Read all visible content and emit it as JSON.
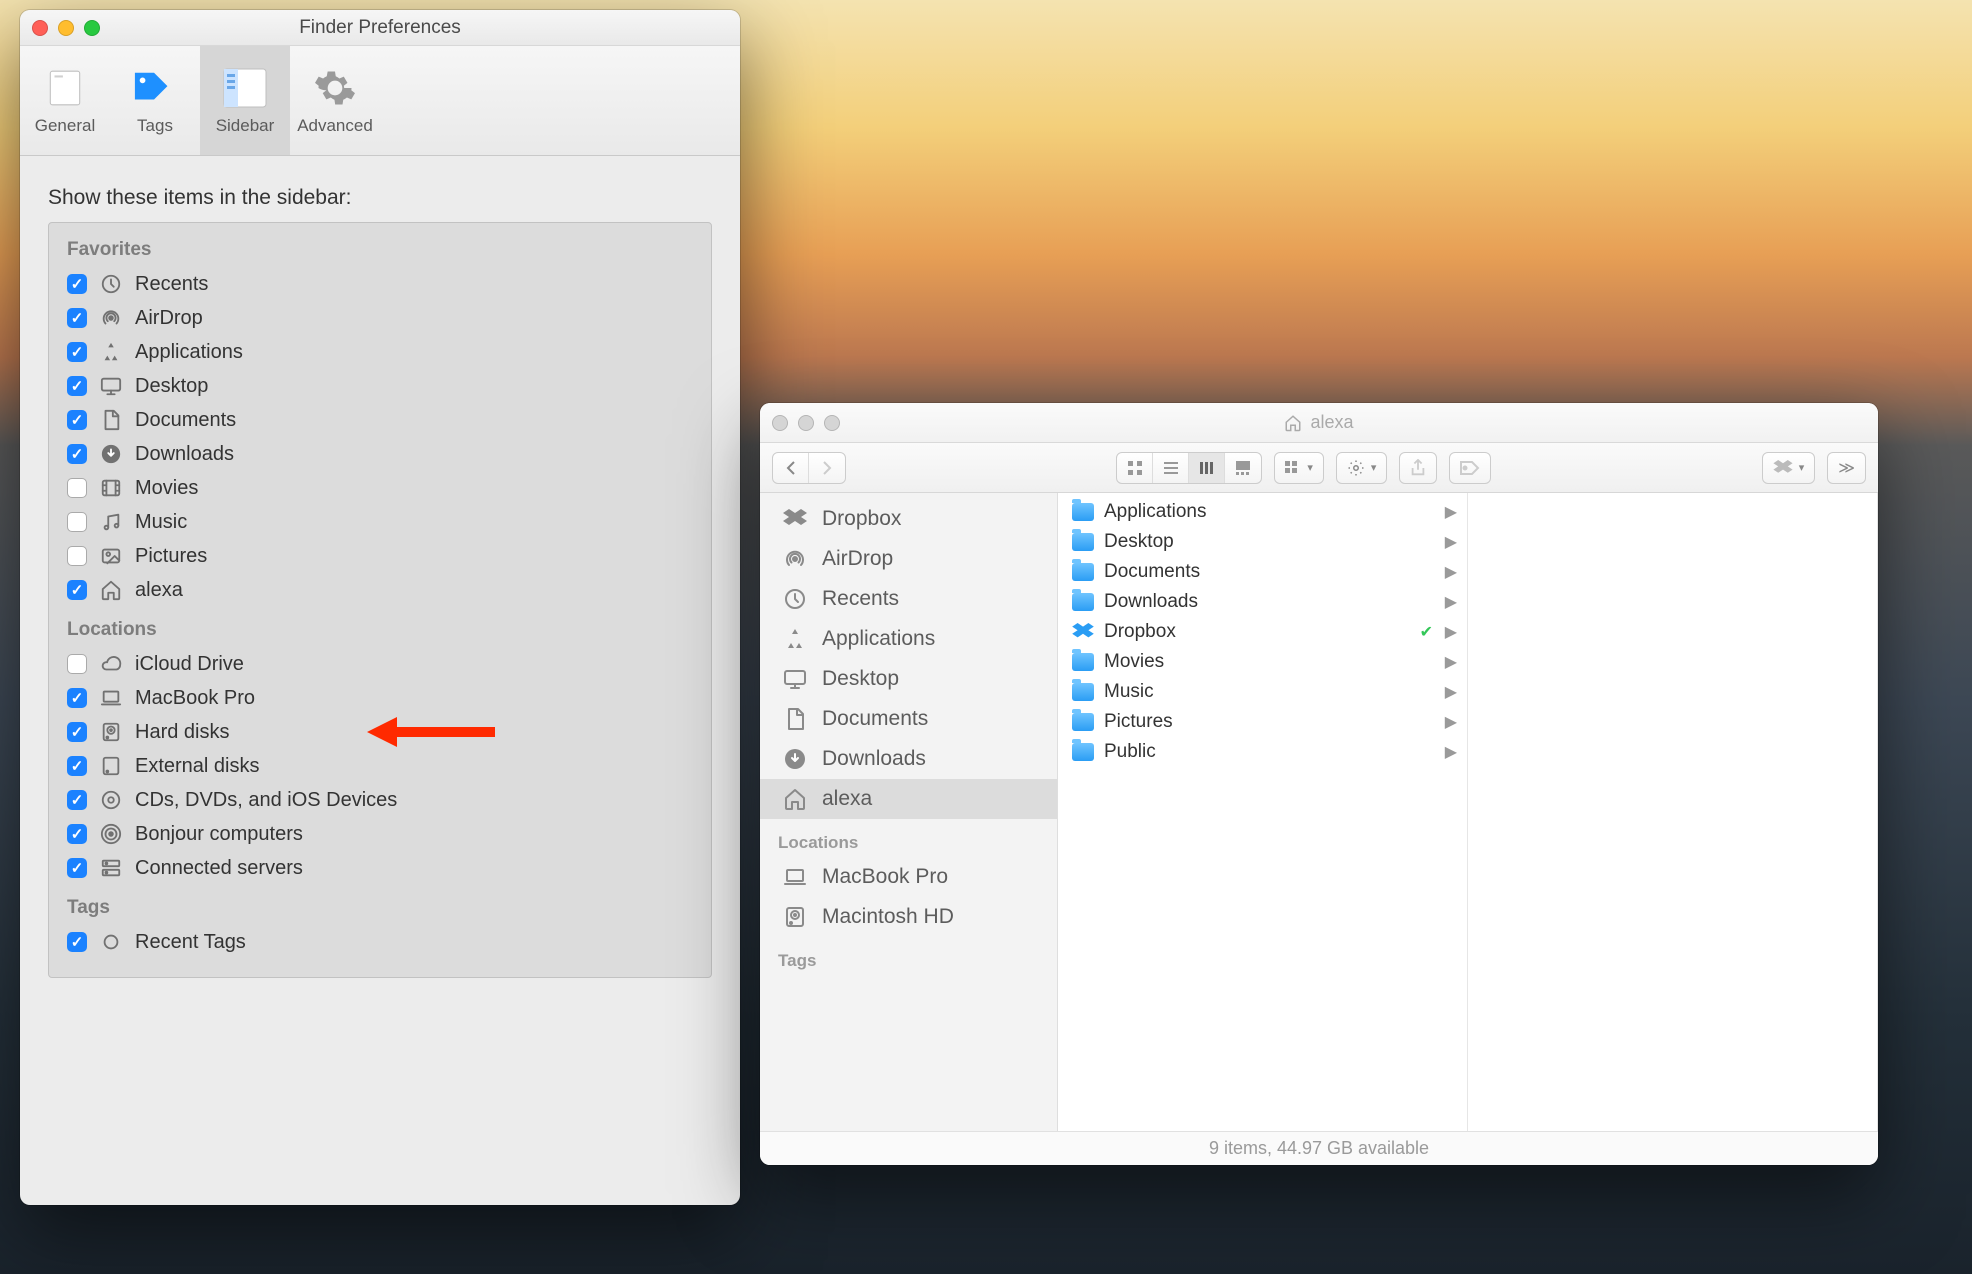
{
  "prefs": {
    "title": "Finder Preferences",
    "tabs": [
      {
        "label": "General",
        "icon": "general"
      },
      {
        "label": "Tags",
        "icon": "tags"
      },
      {
        "label": "Sidebar",
        "icon": "sidebar",
        "selected": true
      },
      {
        "label": "Advanced",
        "icon": "advanced"
      }
    ],
    "heading": "Show these items in the sidebar:",
    "groups": [
      {
        "title": "Favorites",
        "items": [
          {
            "label": "Recents",
            "icon": "recents",
            "checked": true
          },
          {
            "label": "AirDrop",
            "icon": "airdrop",
            "checked": true
          },
          {
            "label": "Applications",
            "icon": "apps",
            "checked": true
          },
          {
            "label": "Desktop",
            "icon": "desktop",
            "checked": true
          },
          {
            "label": "Documents",
            "icon": "document",
            "checked": true
          },
          {
            "label": "Downloads",
            "icon": "download",
            "checked": true
          },
          {
            "label": "Movies",
            "icon": "movies",
            "checked": false
          },
          {
            "label": "Music",
            "icon": "music",
            "checked": false
          },
          {
            "label": "Pictures",
            "icon": "pictures",
            "checked": false
          },
          {
            "label": "alexa",
            "icon": "home",
            "checked": true
          }
        ]
      },
      {
        "title": "Locations",
        "items": [
          {
            "label": "iCloud Drive",
            "icon": "cloud",
            "checked": false
          },
          {
            "label": "MacBook Pro",
            "icon": "laptop",
            "checked": true
          },
          {
            "label": "Hard disks",
            "icon": "hdd",
            "checked": true,
            "arrow": true
          },
          {
            "label": "External disks",
            "icon": "external",
            "checked": true
          },
          {
            "label": "CDs, DVDs, and iOS Devices",
            "icon": "disc",
            "checked": true
          },
          {
            "label": "Bonjour computers",
            "icon": "bonjour",
            "checked": true
          },
          {
            "label": "Connected servers",
            "icon": "server",
            "checked": true
          }
        ]
      },
      {
        "title": "Tags",
        "items": [
          {
            "label": "Recent Tags",
            "icon": "tag",
            "checked": true
          }
        ]
      }
    ]
  },
  "finder": {
    "title": "alexa",
    "sidebar": [
      {
        "label": "Dropbox",
        "icon": "dropbox"
      },
      {
        "label": "AirDrop",
        "icon": "airdrop"
      },
      {
        "label": "Recents",
        "icon": "recents"
      },
      {
        "label": "Applications",
        "icon": "apps"
      },
      {
        "label": "Desktop",
        "icon": "desktop"
      },
      {
        "label": "Documents",
        "icon": "document"
      },
      {
        "label": "Downloads",
        "icon": "download"
      },
      {
        "label": "alexa",
        "icon": "home",
        "selected": true
      }
    ],
    "sidebar_sections": [
      {
        "title": "Locations",
        "items": [
          {
            "label": "MacBook Pro",
            "icon": "laptop"
          },
          {
            "label": "Macintosh HD",
            "icon": "hdd"
          }
        ]
      },
      {
        "title": "Tags",
        "items": []
      }
    ],
    "column_items": [
      {
        "label": "Applications"
      },
      {
        "label": "Desktop"
      },
      {
        "label": "Documents"
      },
      {
        "label": "Downloads"
      },
      {
        "label": "Dropbox",
        "dropbox": true,
        "synced": true
      },
      {
        "label": "Movies"
      },
      {
        "label": "Music"
      },
      {
        "label": "Pictures"
      },
      {
        "label": "Public"
      }
    ],
    "status": "9 items, 44.97 GB available"
  }
}
